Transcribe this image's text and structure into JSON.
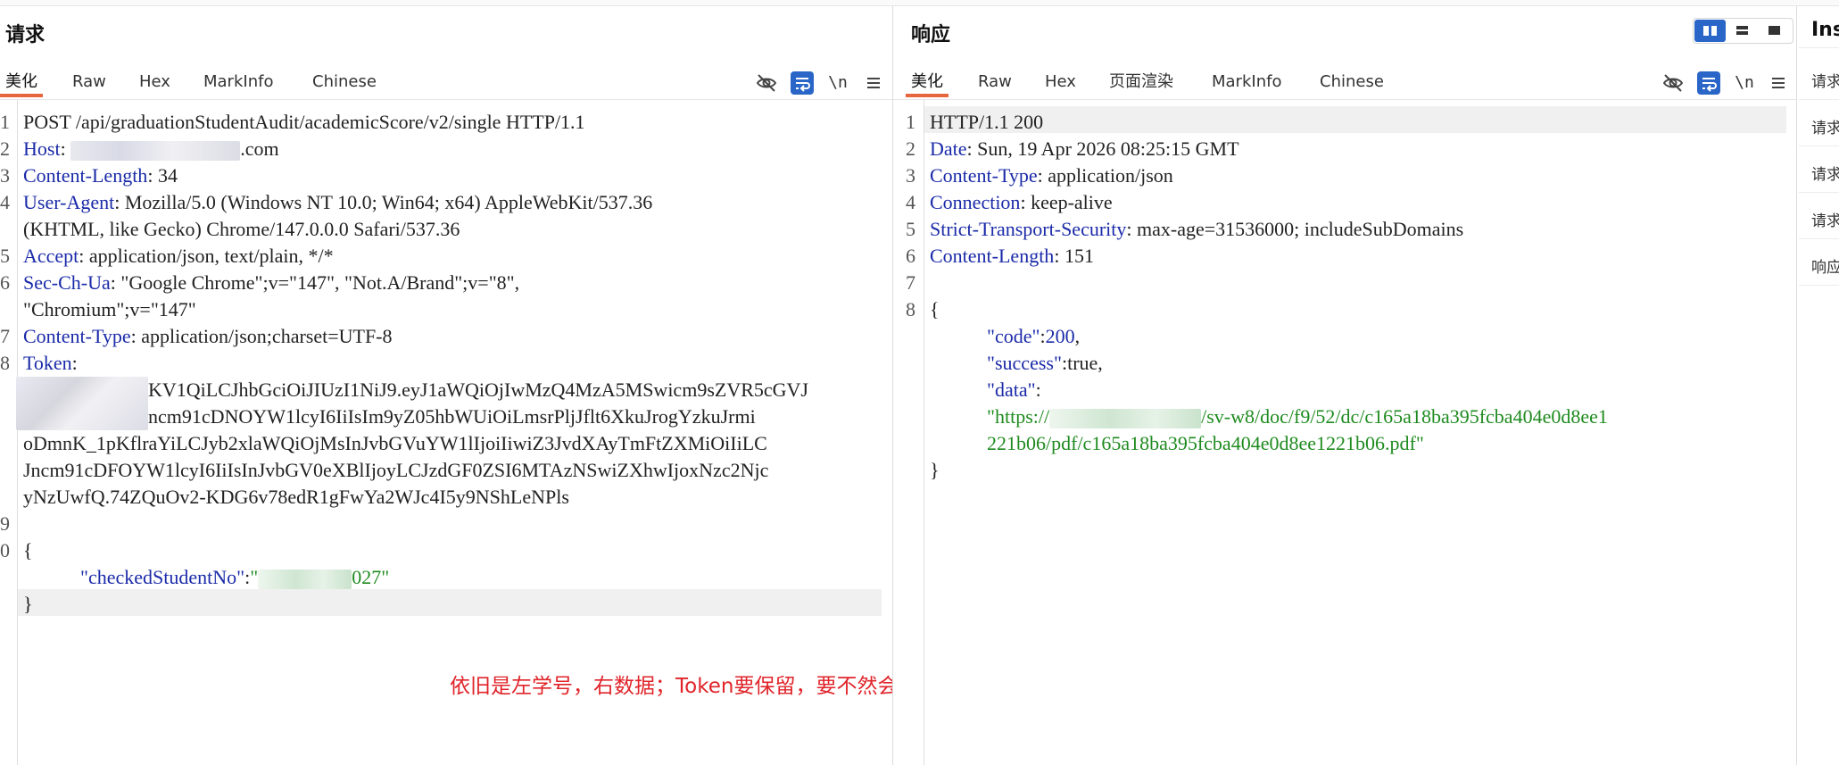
{
  "request": {
    "title": "请求",
    "tabs": [
      "美化",
      "Raw",
      "Hex",
      "MarkInfo",
      "Chinese"
    ],
    "newline_label": "\\n",
    "line_numbers": [
      "1",
      "2",
      "3",
      "4",
      "5",
      "6",
      "7",
      "8",
      "9",
      "0"
    ],
    "line1": "POST /api/graduationStudentAudit/academicScore/v2/single HTTP/1.1",
    "host_key": "Host",
    "host_suffix": ".com",
    "content_length_key": "Content-Length",
    "content_length_val": " 34",
    "ua_key": "User-Agent",
    "ua_val": " Mozilla/5.0 (Windows NT 10.0; Win64; x64) AppleWebKit/537.36",
    "ua_val2": "(KHTML, like Gecko) Chrome/147.0.0.0 Safari/537.36",
    "accept_key": "Accept",
    "accept_val": " application/json, text/plain, */*",
    "secchua_key": "Sec-Ch-Ua",
    "secchua_val": " \"Google Chrome\";v=\"147\", \"Not.A/Brand\";v=\"8\",",
    "secchua_val2": "\"Chromium\";v=\"147\"",
    "ct_key": "Content-Type",
    "ct_val": " application/json;charset=UTF-8",
    "token_key": "Token",
    "token_lines": [
      "KV1QiLCJhbGciOiJIUzI1NiJ9.eyJ1aWQiOjIwMzQ4MzA5MSwicm9sZVR5cGVJ",
      "ncm91cDNOYW1lcyI6IiIsIm9yZ05hbWUiOiLmsrPljJflt6XkuJrogYzkuJrmi",
      "oDmnK_1pKflraYiLCJyb2xlaWQiOjMsInJvbGVuYW1lIjoiIiwiZ3JvdXAyTmFtZXMiOiIiLC",
      "Jncm91cDFOYW1lcyI6IiIsInJvbGV0eXBlIjoyLCJzdGF0ZSI6MTAzNSwiZXhwIjoxNzc2Njc",
      "yNzUwfQ.74ZQuOv2-KDG6v78edR1gFwYa2WJc4I5y9NShLeNPls"
    ],
    "body_open": "{",
    "body_key": "\"checkedStudentNo\"",
    "body_colon": ":",
    "body_val_quote": "\"",
    "body_val_suffix": "027\"",
    "body_close": "}"
  },
  "response": {
    "title": "响应",
    "tabs": [
      "美化",
      "Raw",
      "Hex",
      "页面渲染",
      "MarkInfo",
      "Chinese"
    ],
    "newline_label": "\\n",
    "line_numbers": [
      "1",
      "2",
      "3",
      "4",
      "5",
      "6",
      "7",
      "8"
    ],
    "line1": "HTTP/1.1 200",
    "date_key": "Date",
    "date_val": " Sun, 19 Apr 2026 08:25:15 GMT",
    "ct_key": "Content-Type",
    "ct_val": " application/json",
    "conn_key": "Connection",
    "conn_val": " keep-alive",
    "sts_key": "Strict-Transport-Security",
    "sts_val": " max-age=31536000; includeSubDomains",
    "cl_key": "Content-Length",
    "cl_val": " 151",
    "body_open": "{",
    "code_key": "\"code\"",
    "code_val": "200",
    "success_key": "\"success\"",
    "success_val": "true",
    "comma": ",",
    "colon": ":",
    "data_key": "\"data\"",
    "data_val_prefix": "\"https://",
    "data_val_mid": "/sv-w8/doc/f9/52/dc/c165a18ba395fcba404e0d8ee1",
    "data_val_line2": "221b06/pdf/c165a18ba395fcba404e0d8ee1221b06.pdf\"",
    "body_close": "}"
  },
  "annotation": "依旧是左学号，右数据；Token要保留，要不然会提示登录",
  "inspector": {
    "title": "Ins",
    "items": [
      "请求",
      "请求",
      "请求",
      "请求",
      "响应"
    ]
  },
  "colors": {
    "accent_blue": "#2a66c8",
    "tab_underline": "#e8663d",
    "header_key": "#1a2aa8",
    "string_green": "#1f8b1f",
    "annotation_red": "#e0242a"
  }
}
